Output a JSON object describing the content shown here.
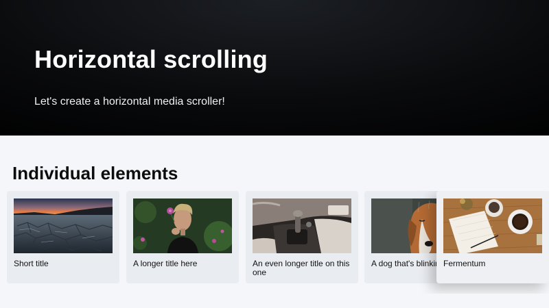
{
  "hero": {
    "title": "Horizontal scrolling",
    "subtitle": "Let's create a horizontal media scroller!"
  },
  "section": {
    "title": "Individual elements"
  },
  "cards": [
    {
      "title": "Short title",
      "image": "desert-sunset-cracked-earth"
    },
    {
      "title": "A longer title here",
      "image": "man-holding-flower"
    },
    {
      "title": "An even longer title on this one",
      "image": "car-interior-gear-shifter"
    },
    {
      "title": "A dog that's blinking",
      "image": "wet-dog"
    },
    {
      "title": "Fermentum",
      "image": "coffee-notebook-desk"
    }
  ]
}
